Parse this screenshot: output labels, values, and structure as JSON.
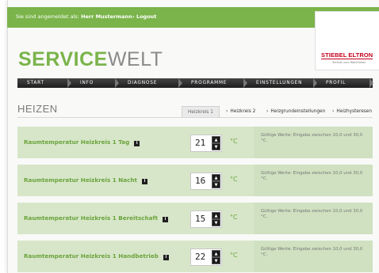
{
  "header": {
    "login_prefix": "Sie sind angemeldet als:",
    "user": "Herr Mustermann",
    "logout_label": "› Logout",
    "brand_name": "STIEBEL ELTRON",
    "brand_tagline": "Technik zum Wohlfühlen"
  },
  "site_title": {
    "part1": "SERVICE",
    "part2": "WELT"
  },
  "nav": {
    "items": [
      {
        "label": "START"
      },
      {
        "label": "INFO"
      },
      {
        "label": "DIAGNOSE"
      },
      {
        "label": "PROGRAMME"
      },
      {
        "label": "EINSTELLUNGEN"
      },
      {
        "label": "PROFIL"
      }
    ]
  },
  "page": {
    "heading": "HEIZEN"
  },
  "tabs": [
    {
      "label": "Heizkreis 1"
    },
    {
      "label": "Heizkreis 2"
    },
    {
      "label": "Heizgrundeinstellungen"
    },
    {
      "label": "Heizhysteresen"
    }
  ],
  "settings": [
    {
      "label": "Raumtemperatur Heizkreis 1 Tag",
      "value": "21",
      "unit": "°C",
      "hint": "Gültige Werte: Eingabe zwischen 10,0 und 30,0 °C."
    },
    {
      "label": "Raumtemperatur Heizkreis 1 Nacht",
      "value": "16",
      "unit": "°C",
      "hint": "Gültige Werte: Eingabe zwischen 10,0 und 30,0 °C."
    },
    {
      "label": "Raumtemperatur Heizkreis 1 Bereitschaft",
      "value": "15",
      "unit": "°C",
      "hint": "Gültige Werte: Eingabe zwischen 10,0 und 30,0 °C."
    },
    {
      "label": "Raumtemperatur Heizkreis 1 Handbetrieb",
      "value": "22",
      "unit": "°C",
      "hint": "Gültige Werte: Eingabe zwischen 10,0 und 30,0 °C."
    }
  ],
  "icons": {
    "info": "info-icon",
    "increase": "chevron-up-icon",
    "decrease": "chevron-down-icon"
  },
  "colors": {
    "accent": "#7ab44a",
    "row_bg": "#d7e6c9",
    "nav_bg": "#2c2c2c",
    "brand_red": "#c5001a"
  }
}
